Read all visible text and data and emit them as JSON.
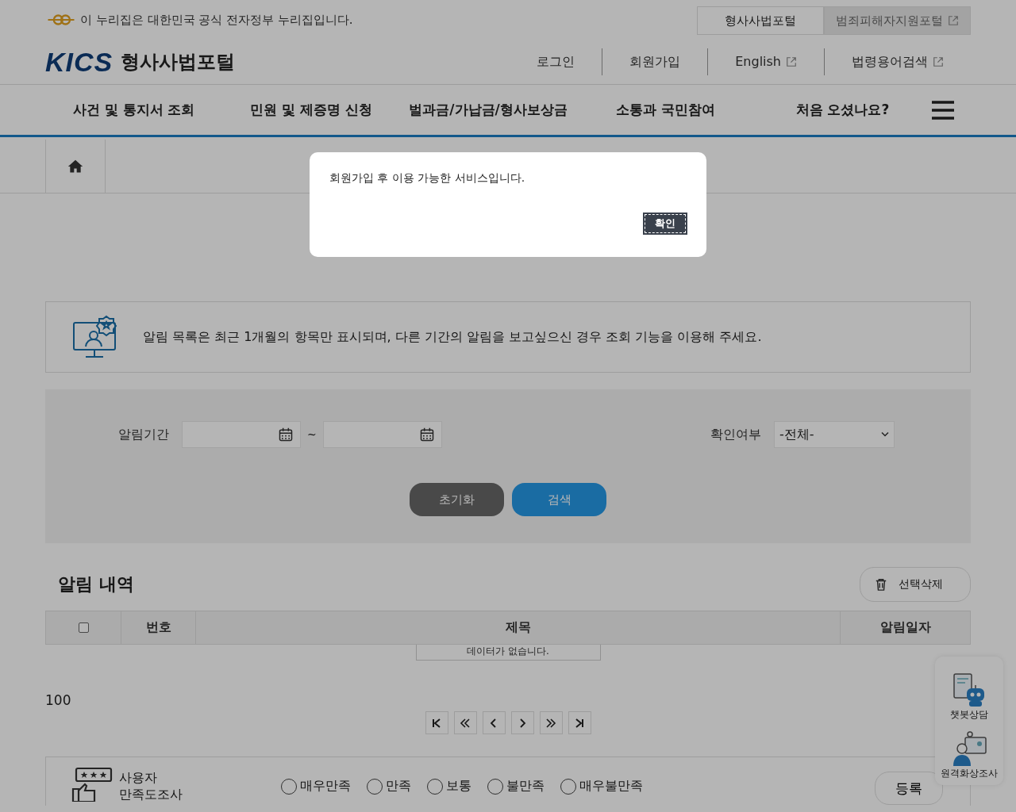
{
  "gov_banner": {
    "text": "이 누리집은 대한민국 공식 전자정부 누리집입니다."
  },
  "site_tabs": [
    {
      "label": "형사사법포털",
      "selected": true,
      "external": false
    },
    {
      "label": "범죄피해자지원포털",
      "selected": false,
      "external": true
    }
  ],
  "logo": {
    "mark": "KICS",
    "name": "형사사법포털"
  },
  "util_links": [
    {
      "label": "로그인",
      "external": false
    },
    {
      "label": "회원가입",
      "external": false
    },
    {
      "label": "English",
      "external": true
    },
    {
      "label": "법령용어검색",
      "external": true
    }
  ],
  "nav": [
    "사건 및 통지서 조회",
    "민원 및 제증명 신청",
    "벌과금/가납금/형사보상금",
    "소통과 국민참여",
    "처음 오셨나요?"
  ],
  "notice": "알림 목록은 최근 1개월의 항목만 표시되며, 다른 기간의 알림을 보고싶으신 경우 조회 기능을 이용해 주세요.",
  "filters": {
    "period_label": "알림기간",
    "separator": "~",
    "confirm_label": "확인여부",
    "confirm_value": "-전체-"
  },
  "search_buttons": [
    {
      "label": "초기화",
      "kind": "reset"
    },
    {
      "label": "검색",
      "kind": "search"
    }
  ],
  "list": {
    "title": "알림 내역",
    "delete_button": "선택삭제",
    "select_all": false,
    "columns": [
      {
        "label": "번호"
      },
      {
        "label": "제목"
      },
      {
        "label": "알림일자"
      }
    ],
    "empty": "데이터가 없습니다."
  },
  "page_size": "100",
  "pagination": [
    {
      "kind": "first"
    },
    {
      "kind": "prev-group"
    },
    {
      "kind": "prev"
    },
    {
      "kind": "next"
    },
    {
      "kind": "next-group"
    },
    {
      "kind": "last"
    }
  ],
  "survey": {
    "title_lines": [
      "사용자",
      "만족도조사"
    ],
    "options": [
      {
        "label": "매우만족",
        "selected": false
      },
      {
        "label": "만족",
        "selected": false
      },
      {
        "label": "보통",
        "selected": false
      },
      {
        "label": "불만족",
        "selected": false
      },
      {
        "label": "매우불만족",
        "selected": false
      }
    ],
    "submit": "등록"
  },
  "quick_menu": [
    {
      "label": "챗봇상담",
      "kind": "chatbot"
    },
    {
      "label": "원격화상조사",
      "kind": "video"
    }
  ],
  "modal": {
    "message": "회원가입 후 이용 가능한 서비스입니다.",
    "confirm": "확인"
  }
}
